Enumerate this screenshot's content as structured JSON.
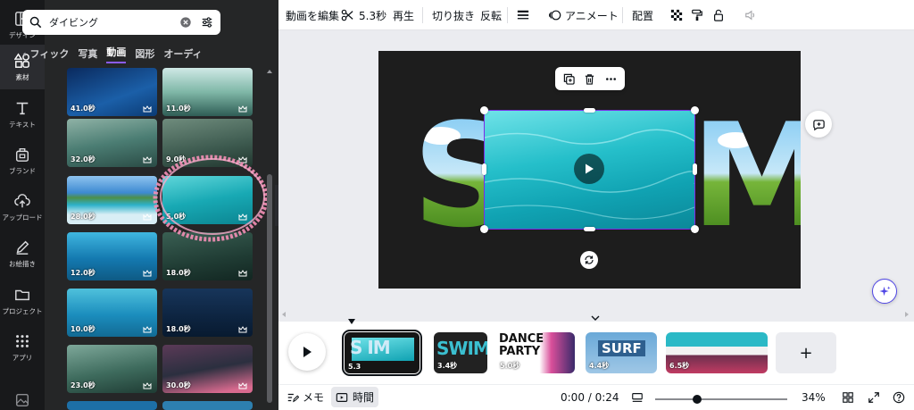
{
  "left_rail": {
    "items": [
      {
        "label": "デザイン",
        "icon": "layout-icon"
      },
      {
        "label": "素材",
        "icon": "shapes-icon"
      },
      {
        "label": "テキスト",
        "icon": "text-icon"
      },
      {
        "label": "ブランド",
        "icon": "brand-icon"
      },
      {
        "label": "アップロード",
        "icon": "cloud-upload-icon"
      },
      {
        "label": "お絵描き",
        "icon": "pen-icon"
      },
      {
        "label": "プロジェクト",
        "icon": "folder-icon"
      },
      {
        "label": "アプリ",
        "icon": "apps-grid-icon"
      }
    ],
    "active_index": 1
  },
  "panel": {
    "search_value": "ダイビング",
    "categories": [
      "フィック",
      "写真",
      "動画",
      "図形",
      "オーディ"
    ],
    "active_category": "動画",
    "thumbnails": [
      {
        "duration": "41.0秒"
      },
      {
        "duration": "11.0秒"
      },
      {
        "duration": "32.0秒"
      },
      {
        "duration": "9.0秒"
      },
      {
        "duration": "28.0秒"
      },
      {
        "duration": "5.0秒"
      },
      {
        "duration": "12.0秒"
      },
      {
        "duration": "18.0秒"
      },
      {
        "duration": "10.0秒"
      },
      {
        "duration": "18.0秒"
      },
      {
        "duration": "23.0秒"
      },
      {
        "duration": "30.0秒"
      }
    ]
  },
  "toolbar": {
    "edit_video": "動画を編集",
    "split_duration": "5.3秒",
    "playback": "再生",
    "crop": "切り抜き",
    "flip": "反転",
    "animate": "アニメート",
    "position": "配置"
  },
  "canvas": {
    "word_left": "S",
    "word_right": "M"
  },
  "timeline": {
    "clips": [
      {
        "text": "S  IM",
        "duration": "5.3"
      },
      {
        "text": "SWIM",
        "duration": "3.4秒"
      },
      {
        "text": "DANCE PARTY",
        "duration": "5.0秒"
      },
      {
        "text": "SURF",
        "duration": "4.4秒"
      },
      {
        "text": "",
        "duration": "6.5秒"
      }
    ],
    "add_label": "+"
  },
  "bottom": {
    "notes": "メモ",
    "time_view": "時間",
    "time": "0:00 / 0:24",
    "zoom": "34%"
  },
  "colors": {
    "accent_purple": "#8b5cf6",
    "selection": "#7d2ae8",
    "rail_bg": "#18191b",
    "panel_bg": "#252627"
  }
}
